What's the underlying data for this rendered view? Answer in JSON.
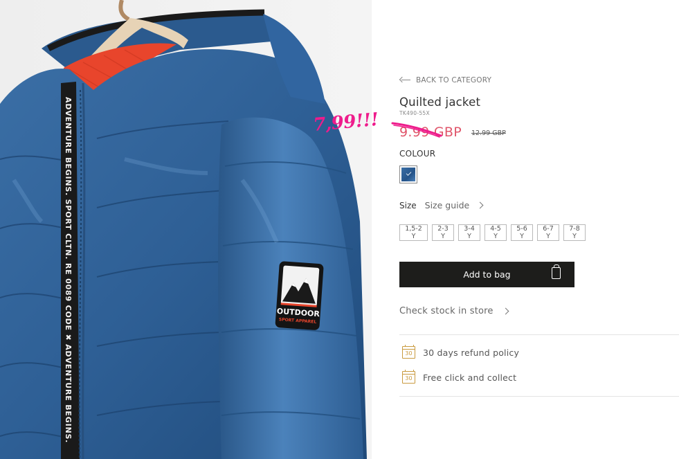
{
  "breadcrumb": {
    "back_label": "BACK TO CATEGORY"
  },
  "product": {
    "name": "Quilted jacket",
    "sku": "TK490-55X",
    "price": "9.99 GBP",
    "old_price": "12.99 GBP",
    "badge_line1": "OUTDOOR",
    "badge_line2": "SPORT APPAREL",
    "tape_text": "ADVENTURE BEGINS. SPORT CLTN. RE 0089 CODE ✖ ADVENTURE BEGINS."
  },
  "colour": {
    "label": "COLOUR",
    "selected_color": "#2f5f96"
  },
  "size": {
    "label": "Size",
    "guide_label": "Size guide",
    "options": [
      "1,5-2 Y",
      "2-3 Y",
      "3-4 Y",
      "4-5 Y",
      "5-6 Y",
      "6-7 Y",
      "7-8 Y"
    ]
  },
  "actions": {
    "add_to_bag": "Add to bag",
    "check_stock": "Check stock in store"
  },
  "perks": [
    {
      "icon": "calendar-30-icon",
      "icon_text": "30",
      "label": "30 days refund policy"
    },
    {
      "icon": "calendar-30-icon",
      "icon_text": "30",
      "label": "Free click and collect"
    }
  ],
  "annotation": {
    "text": "7,99!!!",
    "color": "#ee1c8c"
  },
  "colors": {
    "price": "#e0566b",
    "button": "#1d1d1b",
    "perk_icon": "#c99a3e",
    "jacket": "#2f5f96",
    "lining": "#e8452c"
  }
}
